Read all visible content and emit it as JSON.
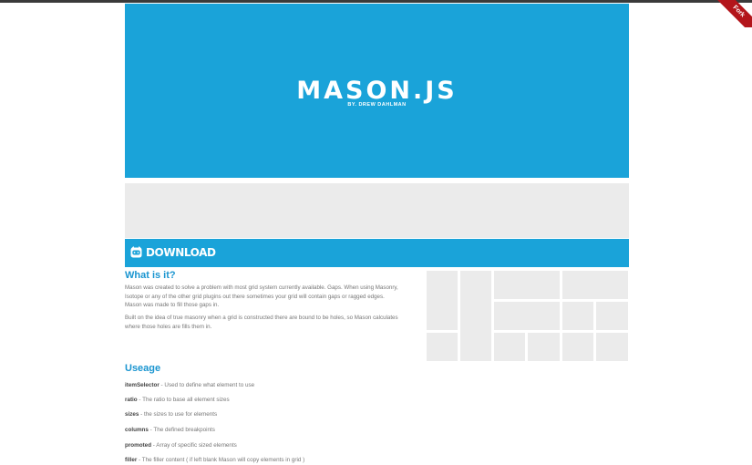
{
  "ribbon": {
    "label": "Fork"
  },
  "hero": {
    "title": "MASON.JS",
    "byline": "BY. DREW DAHLMAN"
  },
  "download": {
    "label": "DOWNLOAD"
  },
  "about": {
    "heading": "What is it?",
    "para1": "Mason was created to solve a problem with most grid system currently available. Gaps. When using Masonry, Isotope or any of the other grid plugins out there sometimes your grid will contain gaps or ragged edges. Mason was made to fill those gaps in.",
    "para2": "Built on the idea of true masonry when a grid is constructed there are bound to be holes, so Mason calculates where those holes are fills them in."
  },
  "usage": {
    "heading": "Useage",
    "options": [
      {
        "name": "itemSelector",
        "desc": " - Used to define what element to use"
      },
      {
        "name": "ratio",
        "desc": " - The ratio to base all element sizes"
      },
      {
        "name": "sizes",
        "desc": " - the sizes to use for elements"
      },
      {
        "name": "columns",
        "desc": " - The defined breakpoints"
      },
      {
        "name": "promoted",
        "desc": " - Array of specific sized elements"
      },
      {
        "name": "filler",
        "desc": " - The filler content ( if left blank Mason will copy elements in grid )"
      }
    ]
  },
  "colors": {
    "accent": "#1aa3d9",
    "placeholder": "#ebebeb",
    "ribbon": "#b3151b"
  }
}
